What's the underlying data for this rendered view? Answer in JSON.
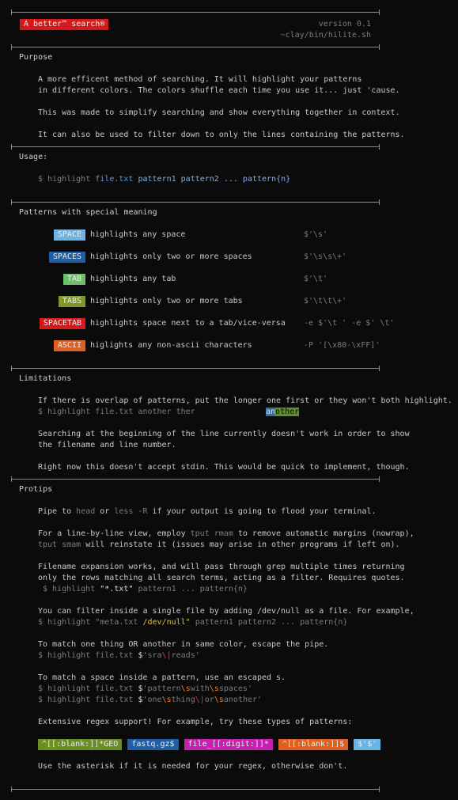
{
  "header": {
    "badge": "A better™ search®",
    "version": "version 0.1",
    "path": "~clay/bin/hilite.sh",
    "badge_color": "#d7191c"
  },
  "purpose": {
    "title": "Purpose",
    "line1": "A more efficent method of searching. It will highlight your patterns",
    "line2": "in different colors. The colors shuffle each time you use it... just 'cause.",
    "line3": "This was made to simplify searching and show everything together in context.",
    "line4": "It can also be used to filter down to only the lines containing the patterns."
  },
  "usage": {
    "title": "Usage:",
    "prompt": "$ highlight",
    "file": "file.txt",
    "patterns": "pattern1 pattern2 ... pattern{n}"
  },
  "special": {
    "title": "Patterns with special meaning",
    "rows": [
      {
        "tag": "SPACE",
        "color": "#6cb4e4",
        "desc": "highlights any space",
        "regex": "$'\\s'"
      },
      {
        "tag": "SPACES",
        "color": "#1f5fa6",
        "desc": "highlights only two or more spaces",
        "regex": "$'\\s\\s\\+'"
      },
      {
        "tag": "TAB",
        "color": "#6fbf6a",
        "desc": "highlights any tab",
        "regex": "$'\\t'"
      },
      {
        "tag": "TABS",
        "color": "#7f9a2a",
        "desc": "highlights only two or more tabs",
        "regex": "$'\\t\\t\\+'"
      },
      {
        "tag": "SPACETAB",
        "color": "#d7191c",
        "desc": "highlights space next to a tab/vice-versa",
        "regex": "-e $'\\t ' -e $' \\t'"
      },
      {
        "tag": "ASCII",
        "color": "#e0601f",
        "desc": "higlights any non-ascii characters",
        "regex": "-P '[\\x80-\\xFF]'"
      }
    ]
  },
  "limitations": {
    "title": "Limitations",
    "line1": "If there is overlap of patterns, put the longer one first or they won't both highlight.",
    "cmd": "$ highlight file.txt another ther",
    "demo_an": "an",
    "demo_other": "other",
    "line3": "Searching at the beginning of the line currently doesn't work in order to show",
    "line4": "the filename and line number.",
    "line5": "Right now this doesn't accept stdin. This would be quick to implement, though."
  },
  "protips": {
    "title": "Protips",
    "pipe_a": "Pipe to ",
    "pipe_head": "head",
    "pipe_or": " or ",
    "pipe_less": "less -R",
    "pipe_b": " if your output is going to flood your terminal.",
    "lbl_a": "For a line-by-line view, employ ",
    "lbl_rmam": "tput rmam",
    "lbl_b": " to remove automatic margins (nowrap),",
    "lbl_smam": "tput smam",
    "lbl_c": " will reinstate it (issues may arise in other programs if left on).",
    "fe_line1": "Filename expansion works, and will pass through grep multiple times returning",
    "fe_line2": "only the rows matching all search terms, acting as a filter. Requires quotes.",
    "fe_cmd": "$ highlight",
    "fe_glob": "\"*.txt\"",
    "fe_rest": "pattern1 ... pattern{n}",
    "null_line": "You can filter inside a single file by adding /dev/null as a file. For example,",
    "null_cmd": "$ highlight \"meta.txt",
    "null_dev": "/dev/null\"",
    "null_rest": " pattern1 pattern2 ... pattern{n}",
    "or_line": "To match one thing OR another in same color, escape the pipe.",
    "or_cmd": "$ highlight file.txt ",
    "or_d": "$",
    "or_q1": "'sra",
    "or_pipe": "\\|",
    "or_q2": "reads'",
    "sp_line": "To match a space inside a pattern, use an escaped s.",
    "sp_cmd": "$ highlight file.txt ",
    "sp1_d": "$",
    "sp1_a": "'pattern",
    "sp1_s1": "\\s",
    "sp1_b": "with",
    "sp1_s2": "\\s",
    "sp1_c": "spaces'",
    "sp2_d": "$",
    "sp2_a": "'one",
    "sp2_s1": "\\s",
    "sp2_b": "thing",
    "sp2_p": "\\|",
    "sp2_c": "or",
    "sp2_s2": "\\s",
    "sp2_e": "another'",
    "regex_line": "Extensive regex support! For example, try these types of patterns:",
    "regex_tags": [
      {
        "text": "^[[:blank:]]*GEO",
        "color": "#6b8e23"
      },
      {
        "text": "fastq.gz$",
        "color": "#1f5fa6"
      },
      {
        "text": "file_[[:digit:]]*",
        "color": "#c71fb0"
      },
      {
        "text": "^[[:blank:]]$",
        "color": "#e0601f"
      },
      {
        "text": "$'$'",
        "color": "#6cb4e4"
      }
    ],
    "last_line": "Use the asterisk if it is needed for your regex, otherwise don't."
  }
}
